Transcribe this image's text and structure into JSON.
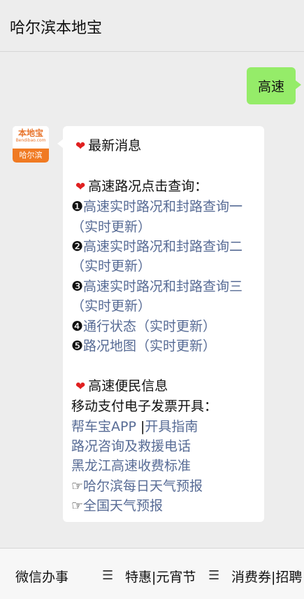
{
  "header": {
    "title": "哈尔滨本地宝"
  },
  "outgoing": {
    "text": "高速"
  },
  "avatar": {
    "logo_text": "本地宝",
    "logo_sub": "Bendibao.com",
    "city": "哈尔滨"
  },
  "reply": {
    "latest": "最新消息",
    "road_query_title": "高速路况点击查询：",
    "items": [
      {
        "num": "❶",
        "text": "高速实时路况和封路查询一（实时更新）"
      },
      {
        "num": "❷",
        "text": "高速实时路况和封路查询二（实时更新）"
      },
      {
        "num": "❸",
        "text": "高速实时路况和封路查询三（实时更新）"
      },
      {
        "num": "❹",
        "text": "通行状态（实时更新）"
      },
      {
        "num": "❺",
        "text": "路况地图（实时更新）"
      }
    ],
    "service_title": "高速便民信息",
    "invoice_label": "移动支付电子发票开具：",
    "app_link": "帮车宝APP",
    "separator": "|",
    "guide_link": "开具指南",
    "rescue_link": "路况咨询及救援电话",
    "fee_link": "黑龙江高速收费标准",
    "weather_prefix": "☞",
    "harbin_weather_link": "哈尔滨每日天气预报",
    "national_weather_link": "全国天气预报"
  },
  "bottom_menu": {
    "item1": "微信办事",
    "item2": "特惠|元宵节",
    "item3": "消费券|招聘"
  },
  "colors": {
    "bubble_green": "#95ec69",
    "link": "#576b95",
    "heart": "#e02020",
    "brand_orange": "#f07a22"
  }
}
